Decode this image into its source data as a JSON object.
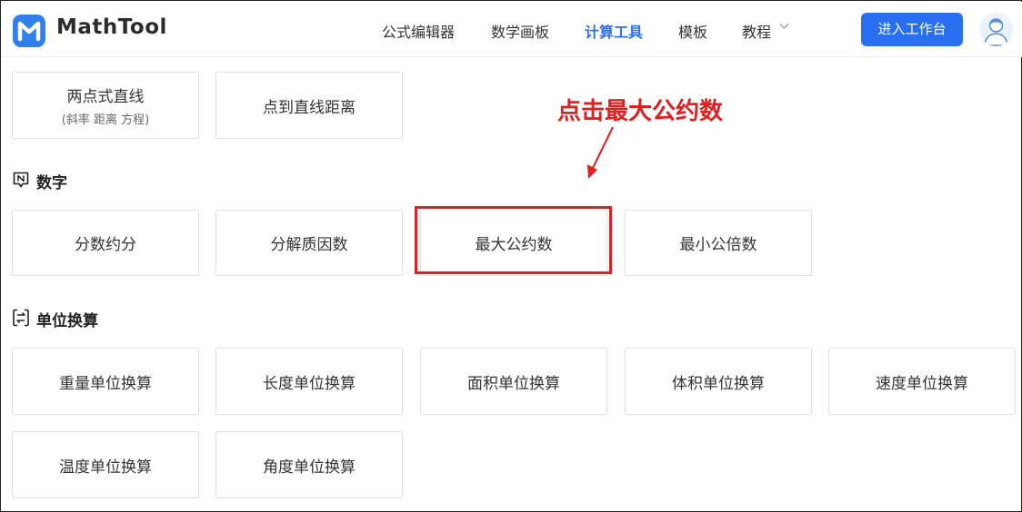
{
  "header": {
    "brand": "MathTool",
    "nav": [
      "公式编辑器",
      "数学画板",
      "计算工具",
      "模板",
      "教程"
    ],
    "active_nav": "计算工具",
    "enter_button": "进入工作台"
  },
  "top_tools": [
    {
      "label": "两点式直线",
      "sub": "(斜率 距离 方程)"
    },
    {
      "label": "点到直线距离"
    }
  ],
  "sections": [
    {
      "title": "数字",
      "icon": "number-badge-icon",
      "tools": [
        "分数约分",
        "分解质因数",
        "最大公约数",
        "最小公倍数"
      ]
    },
    {
      "title": "单位换算",
      "icon": "unit-convert-icon",
      "tools": [
        "重量单位换算",
        "长度单位换算",
        "面积单位换算",
        "体积单位换算",
        "速度单位换算",
        "温度单位换算",
        "角度单位换算"
      ]
    }
  ],
  "annotation": {
    "text": "点击最大公约数",
    "color": "#e02020"
  },
  "colors": {
    "accent": "#2a6ff0",
    "annotation": "#e02020"
  }
}
